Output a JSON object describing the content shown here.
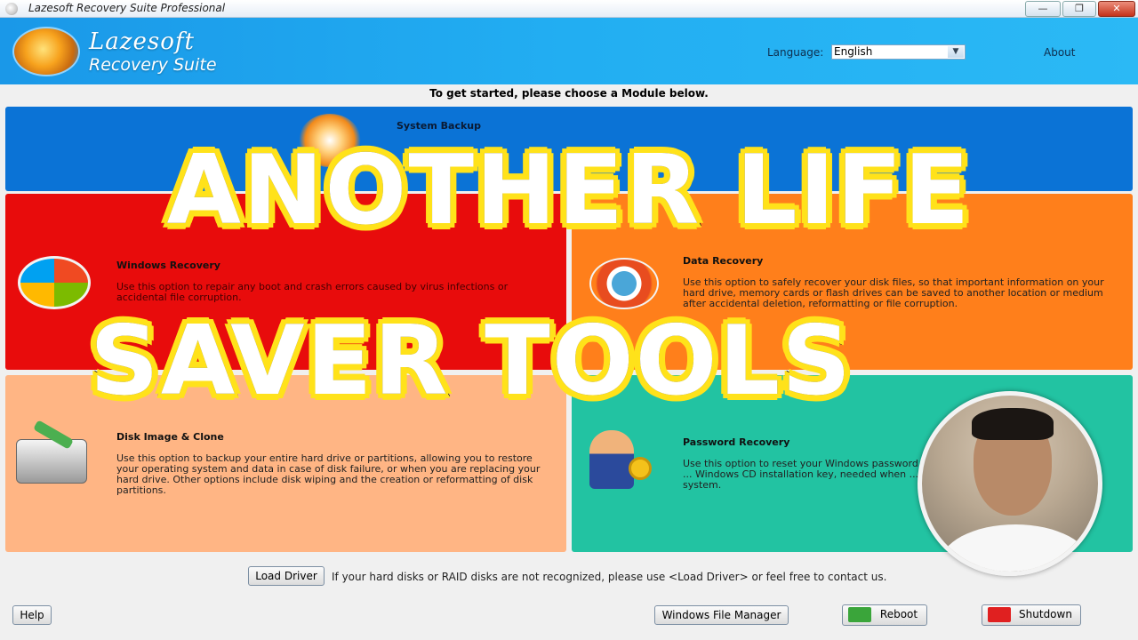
{
  "window": {
    "title": "Lazesoft Recovery Suite Professional",
    "min_label": "—",
    "max_label": "❐",
    "close_label": "✕"
  },
  "header": {
    "logo_line1": "Lazesoft",
    "logo_line2": "Recovery Suite",
    "language_label": "Language:",
    "language_value": "English",
    "about_label": "About"
  },
  "instruction": "To get started, please choose a Module below.",
  "modules": {
    "backup": {
      "title": "System Backup",
      "color": "#0b73d6"
    },
    "windows": {
      "title": "Windows Recovery",
      "desc": "Use this option to repair any boot and crash errors caused by virus infections or accidental file corruption.",
      "color": "#e80c0c"
    },
    "data": {
      "title": "Data Recovery",
      "desc": "Use this option to safely recover your disk files, so that important information on your hard drive, memory cards or flash drives can be saved to another location or medium after accidental deletion, reformatting or file corruption.",
      "color": "#ff7f1b"
    },
    "disk": {
      "title": "Disk Image & Clone",
      "desc": "Use this option to backup your entire hard drive or partitions, allowing you to restore your operating system and data in case of disk failure, or when you are replacing your hard drive. Other options include disk wiping and the creation or reformatting of disk partitions.",
      "color": "#ffb584"
    },
    "password": {
      "title": "Password Recovery",
      "desc": "Use this option to reset your Windows password ... Windows CD installation key, needed when ... system.",
      "color": "#22c3a2"
    }
  },
  "footer": {
    "load_driver": "Load Driver",
    "driver_text": "If your hard disks or RAID disks are not recognized, please use <Load Driver> or feel free to contact us.",
    "help": "Help",
    "file_manager": "Windows File Manager",
    "reboot": "Reboot",
    "shutdown": "Shutdown"
  },
  "overlay": {
    "line1": "ANOTHER LIFE",
    "line2": "SAVER TOOLS"
  }
}
